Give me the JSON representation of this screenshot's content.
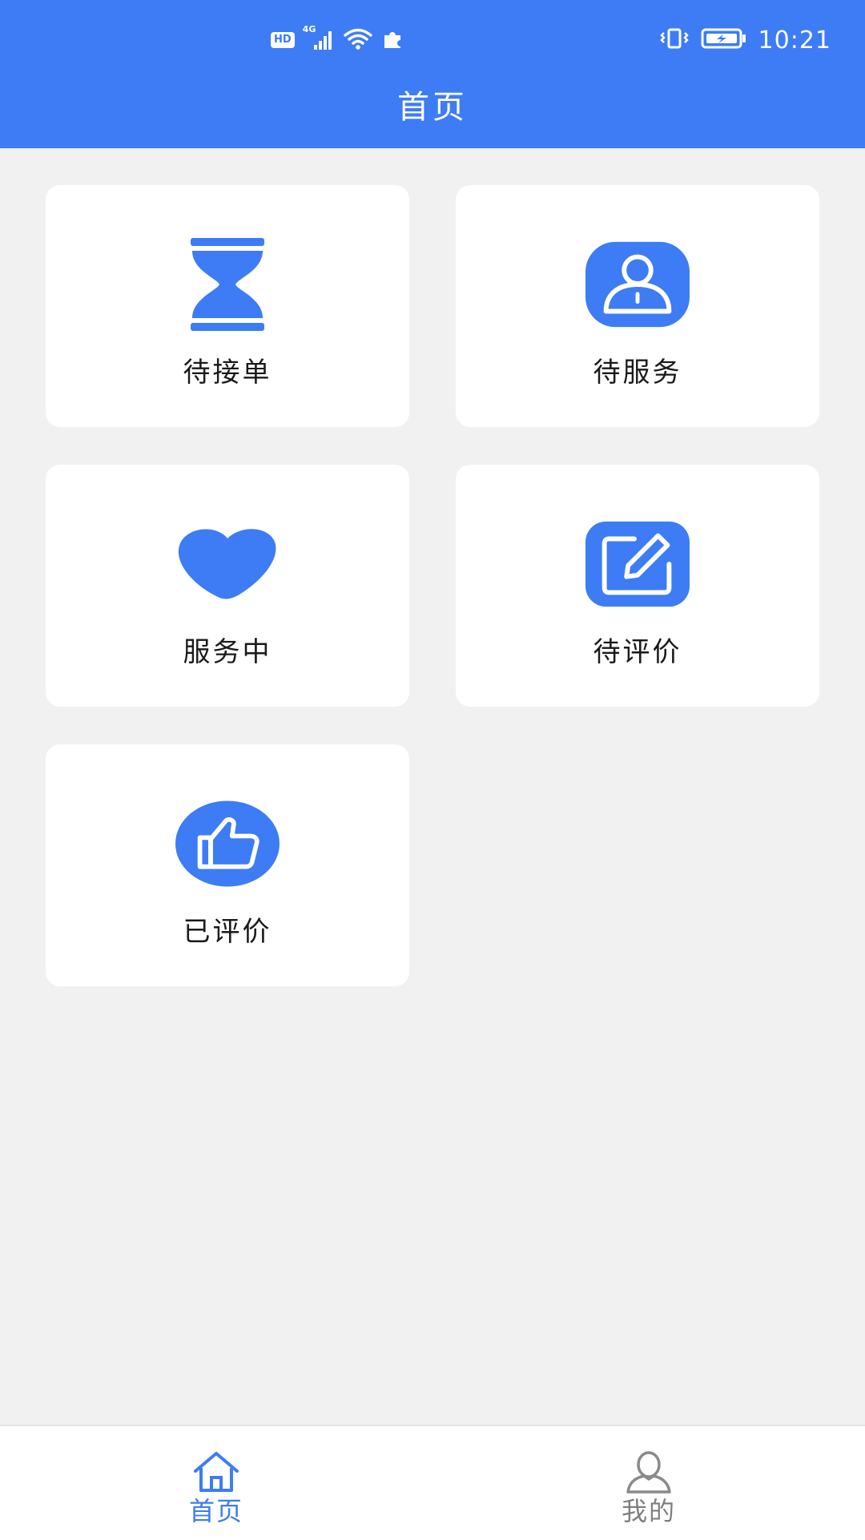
{
  "status_bar": {
    "hd_label": "HD",
    "network_label": "4G",
    "time": "10:21"
  },
  "header": {
    "title": "首页"
  },
  "colors": {
    "brand": "#3d7cf4",
    "background": "#f1f1f1",
    "card": "#ffffff",
    "nav_active": "#3d7cf4",
    "nav_inactive": "#7f7f7f"
  },
  "cards": [
    {
      "label": "待接单",
      "icon": "hourglass-icon"
    },
    {
      "label": "待服务",
      "icon": "user-icon"
    },
    {
      "label": "服务中",
      "icon": "heart-icon"
    },
    {
      "label": "待评价",
      "icon": "edit-icon"
    },
    {
      "label": "已评价",
      "icon": "thumbs-up-icon"
    }
  ],
  "bottom_nav": {
    "items": [
      {
        "label": "首页",
        "icon": "home-icon",
        "active": true
      },
      {
        "label": "我的",
        "icon": "person-icon",
        "active": false
      }
    ]
  }
}
